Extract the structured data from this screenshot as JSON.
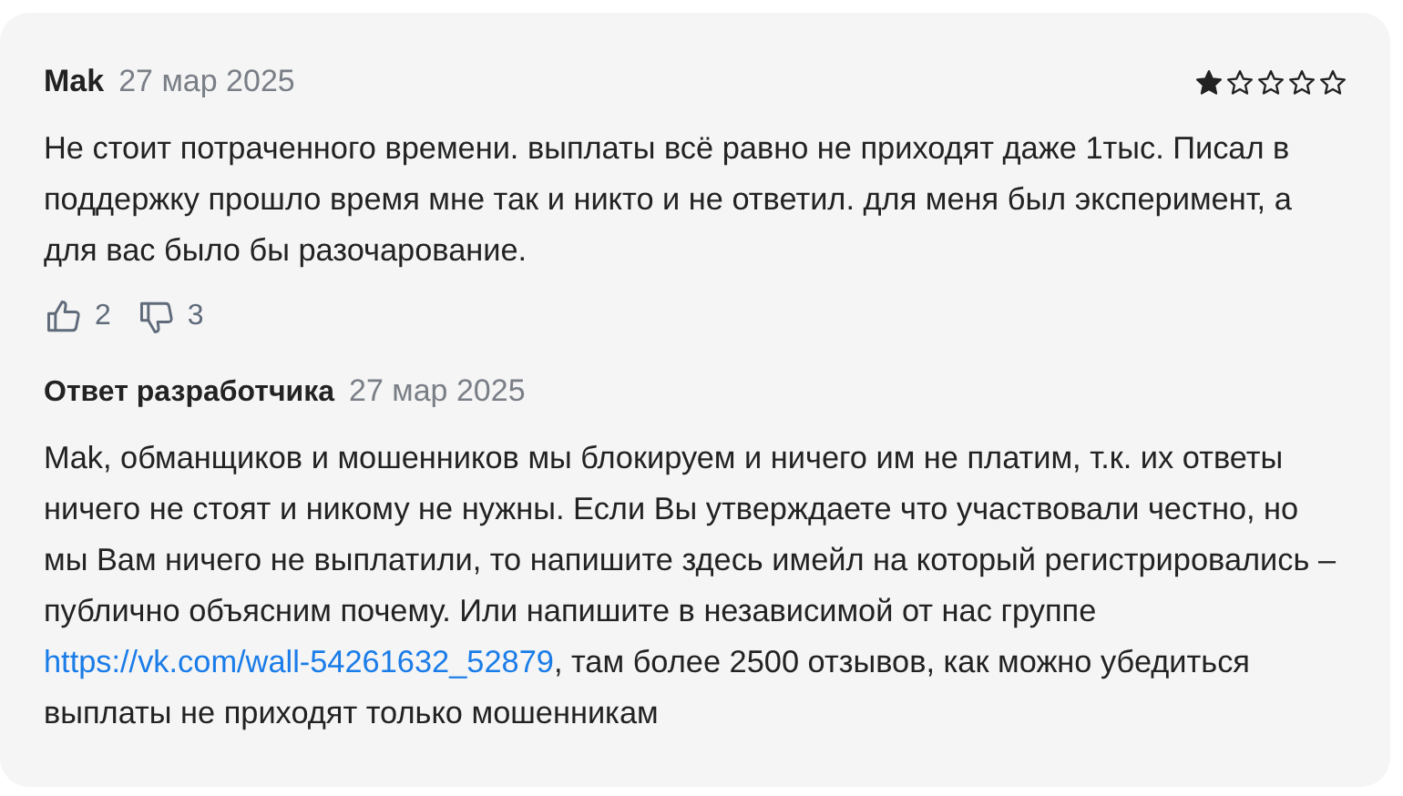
{
  "review": {
    "author": "Mak",
    "date": "27 мар 2025",
    "stars": 1,
    "text": "Не стоит потраченного времени. выплаты всё равно не приходят даже 1тыс. Писал в поддержку прошло время мне так и никто и не ответил. для меня был эксперимент, а для вас было бы разочарование.",
    "likes": "2",
    "dislikes": "3"
  },
  "reply": {
    "title": "Ответ разработчика",
    "date": "27 мар 2025",
    "text_before": "Mak, обманщиков и мошенников мы блокируем и ничего им не платим, т.к. их ответы ничего не стоят и никому не нужны. Если Вы утверждаете что участвовали честно, но мы Вам ничего не выплатили, то напишите здесь имейл на который регистрировались – публично объясним почему. Или напишите в независимой от нас группе ",
    "link": "https://vk.com/wall-54261632_52879",
    "text_after": ", там более 2500 отзывов, как можно убедиться выплаты не приходят только мошенникам"
  }
}
